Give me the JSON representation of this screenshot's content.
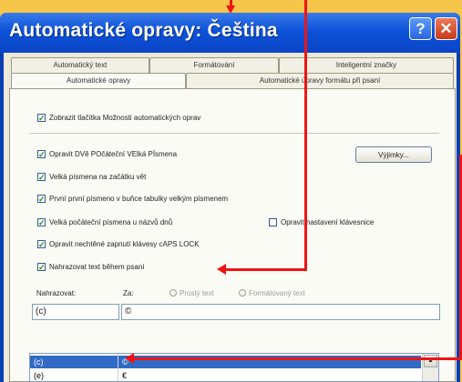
{
  "dialog": {
    "title": "Automatické opravy: Čeština",
    "help_label": "?",
    "close_label": "✕"
  },
  "tabs": {
    "top": [
      "Automatický text",
      "Formátování",
      "Inteligentní značky"
    ],
    "bottom": [
      "Automatické opravy",
      "Automatické úpravy formátu při psaní"
    ]
  },
  "options": {
    "show_buttons": "Zobrazit tlačítka Možnosti automatických oprav",
    "two_initial_caps": "Opravit DVě POčáteční VElká PÍsmena",
    "capitalize_sentence": "Velká písmena na začátku vět",
    "capitalize_table": "První první písmeno v buňce tabulky velkým písmenem",
    "capitalize_days": "Velká počáteční písmena u názvů dnů",
    "fix_keyboard": "Opravit nastavení klávesnice",
    "caps_lock": "Opravit nechtěné zapnutí klávesy cAPS LOCK",
    "replace_text": "Nahrazovat text během psaní"
  },
  "exceptions_button": "Výjimky...",
  "replace": {
    "replace_label": "Nahrazovat:",
    "with_label": "Za:",
    "plain_text": "Prostý text",
    "formatted_text": "Formátovaný text",
    "replace_value": "(c)",
    "with_value": "©"
  },
  "list": {
    "rows": [
      {
        "from": "(c)",
        "to": "©",
        "selected": true
      },
      {
        "from": "(e)",
        "to": "€",
        "selected": false
      }
    ]
  },
  "scroll_up": "▲"
}
